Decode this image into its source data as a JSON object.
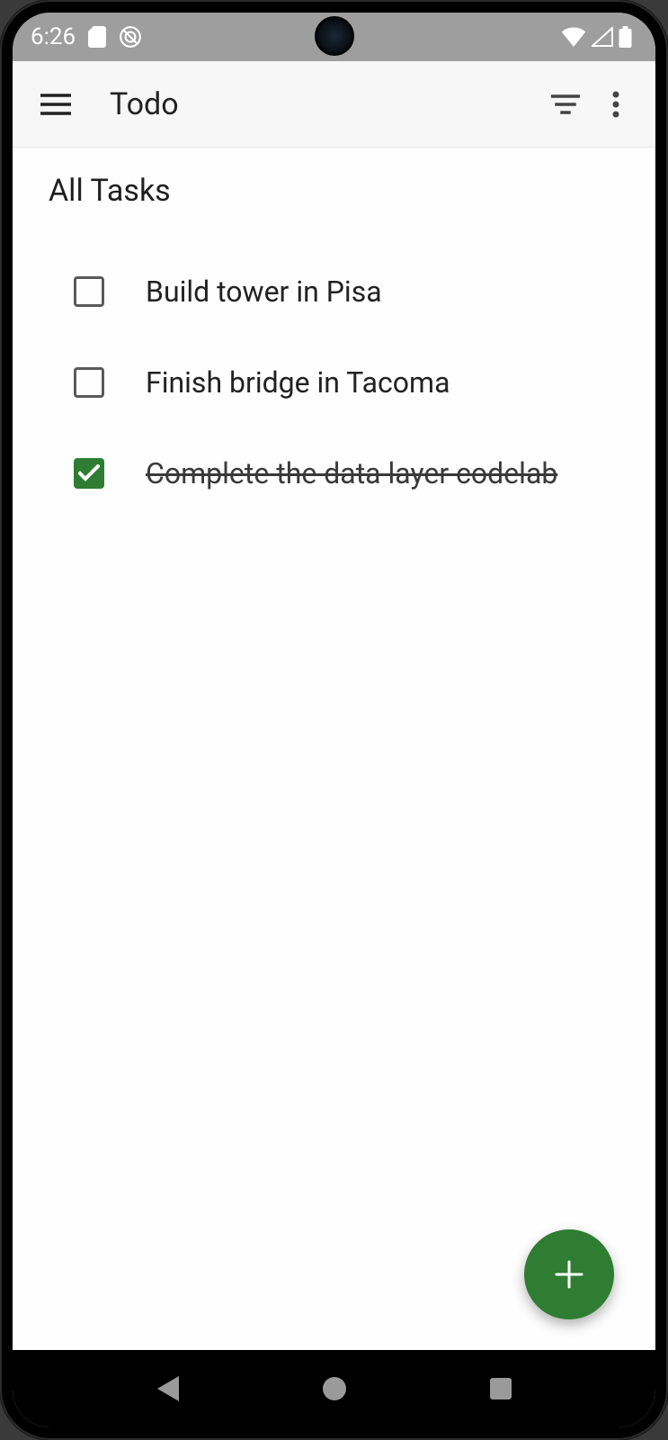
{
  "status_bar": {
    "time": "6:26"
  },
  "app_bar": {
    "title": "Todo"
  },
  "section": {
    "title": "All Tasks"
  },
  "tasks": [
    {
      "label": "Build tower in Pisa",
      "completed": false
    },
    {
      "label": "Finish bridge in Tacoma",
      "completed": false
    },
    {
      "label": "Complete the data layer codelab",
      "completed": true
    }
  ],
  "colors": {
    "accent": "#2e7d32"
  }
}
